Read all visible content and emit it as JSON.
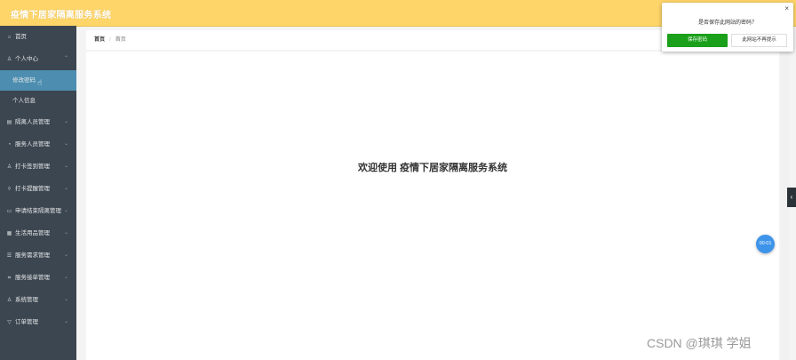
{
  "header": {
    "title": "疫情下居家隔离服务系统"
  },
  "sidebar": {
    "items": [
      {
        "label": "首页",
        "icon": "⌂",
        "has_chevron": false
      },
      {
        "label": "个人中心",
        "icon": "♙",
        "has_chevron": true,
        "chevron": "⌃"
      },
      {
        "label": "隔离人员管理",
        "icon": "▤",
        "has_chevron": true,
        "chevron": "⌄"
      },
      {
        "label": "服务人员管理",
        "icon": "◔",
        "has_chevron": true,
        "chevron": "⌄"
      },
      {
        "label": "打卡签到管理",
        "icon": "♙",
        "has_chevron": true,
        "chevron": "⌄"
      },
      {
        "label": "打卡提醒管理",
        "icon": "◊",
        "has_chevron": true,
        "chevron": "⌄"
      },
      {
        "label": "申请结束隔离管理",
        "icon": "▭",
        "has_chevron": true,
        "chevron": "⌄"
      },
      {
        "label": "生活用品管理",
        "icon": "▦",
        "has_chevron": true,
        "chevron": "⌄"
      },
      {
        "label": "服务需求管理",
        "icon": "☰",
        "has_chevron": true,
        "chevron": "⌄"
      },
      {
        "label": "服务接单管理",
        "icon": "⌗",
        "has_chevron": true,
        "chevron": "⌄"
      },
      {
        "label": "系统管理",
        "icon": "♙",
        "has_chevron": true,
        "chevron": "⌄"
      },
      {
        "label": "订单管理",
        "icon": "▽",
        "has_chevron": true,
        "chevron": "⌄"
      }
    ],
    "sub_items": [
      {
        "label": "修改密码",
        "active": true
      },
      {
        "label": "个人信息",
        "active": false
      }
    ]
  },
  "breadcrumb": {
    "home": "首页",
    "sep": "/",
    "current": "首页"
  },
  "main": {
    "welcome": "欢迎使用 疫情下居家隔离服务系统"
  },
  "float_button": {
    "label": "00:01"
  },
  "right_tab": {
    "icon": "‹"
  },
  "dialog": {
    "close": "×",
    "message": "是否保存此网站的密码？",
    "save_label": "保存密码",
    "never_label": "此网站不再提示"
  },
  "watermark": "CSDN @琪琪 学姐",
  "colors": {
    "header": "#fed569",
    "sidebar": "#3c4650",
    "active": "#4d8eb0",
    "save": "#1aa01a"
  }
}
